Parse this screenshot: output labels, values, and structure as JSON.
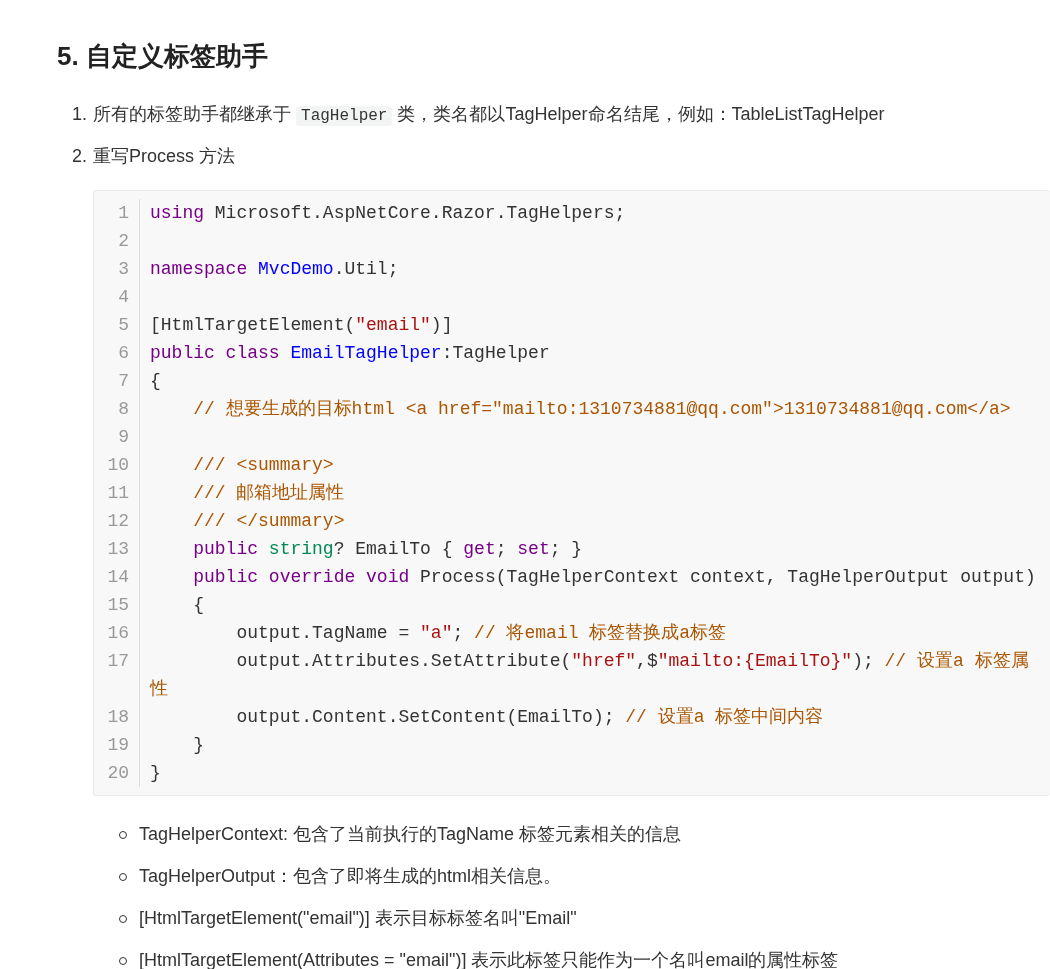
{
  "heading": "5. 自定义标签助手",
  "steps": [
    {
      "number": "1.",
      "parts": [
        {
          "kind": "text",
          "text": "所有的标签助手都继承于 "
        },
        {
          "kind": "code",
          "text": "TagHelper"
        },
        {
          "kind": "text",
          "text": " 类，类名都以TagHelper命名结尾，例如：TableListTagHelper"
        }
      ]
    },
    {
      "number": "2.",
      "parts": [
        {
          "kind": "text",
          "text": "重写Process 方法"
        }
      ]
    }
  ],
  "code_block": {
    "lines": [
      {
        "number": "1",
        "tokens": [
          {
            "kind": "keyword",
            "text": "using"
          },
          {
            "kind": "plain",
            "text": " Microsoft.AspNetCore.Razor.TagHelpers;"
          }
        ]
      },
      {
        "number": "2"
      },
      {
        "number": "3",
        "tokens": [
          {
            "kind": "keyword",
            "text": "namespace "
          },
          {
            "kind": "type",
            "text": "MvcDemo"
          },
          {
            "kind": "plain",
            "text": ".Util;"
          }
        ]
      },
      {
        "number": "4"
      },
      {
        "number": "5",
        "tokens": [
          {
            "kind": "plain",
            "text": "[HtmlTargetElement("
          },
          {
            "kind": "string",
            "text": "\"email\""
          },
          {
            "kind": "plain",
            "text": ")]"
          }
        ]
      },
      {
        "number": "6",
        "tokens": [
          {
            "kind": "keyword",
            "text": "public class "
          },
          {
            "kind": "type",
            "text": "EmailTagHelper"
          },
          {
            "kind": "plain",
            "text": ":TagHelper"
          }
        ]
      },
      {
        "number": "7",
        "tokens": [
          {
            "kind": "plain",
            "text": "{"
          }
        ]
      },
      {
        "number": "8",
        "tokens": [
          {
            "kind": "comment",
            "text": "    // 想要生成的目标html <a href=\"mailto:1310734881@qq.com\">1310734881@qq.com</a>"
          }
        ]
      },
      {
        "number": "9"
      },
      {
        "number": "10",
        "tokens": [
          {
            "kind": "comment",
            "text": "    /// <summary>"
          }
        ]
      },
      {
        "number": "11",
        "tokens": [
          {
            "kind": "comment",
            "text": "    /// 邮箱地址属性"
          }
        ]
      },
      {
        "number": "12",
        "tokens": [
          {
            "kind": "comment",
            "text": "    /// </summary>"
          }
        ]
      },
      {
        "number": "13",
        "tokens": [
          {
            "kind": "keyword",
            "text": "    public "
          },
          {
            "kind": "builtin",
            "text": "string"
          },
          {
            "kind": "plain",
            "text": "? EmailTo { "
          },
          {
            "kind": "keyword",
            "text": "get"
          },
          {
            "kind": "plain",
            "text": "; "
          },
          {
            "kind": "keyword",
            "text": "set"
          },
          {
            "kind": "plain",
            "text": "; }"
          }
        ]
      },
      {
        "number": "14",
        "tokens": [
          {
            "kind": "keyword",
            "text": "    public override void"
          },
          {
            "kind": "plain",
            "text": " Process(TagHelperContext context, TagHelperOutput output)"
          }
        ]
      },
      {
        "number": "15",
        "tokens": [
          {
            "kind": "plain",
            "text": "    {"
          }
        ]
      },
      {
        "number": "16",
        "tokens": [
          {
            "kind": "plain",
            "text": "        output.TagName = "
          },
          {
            "kind": "string",
            "text": "\"a\""
          },
          {
            "kind": "plain",
            "text": "; "
          },
          {
            "kind": "comment",
            "text": "// 将email 标签替换成a标签"
          }
        ]
      },
      {
        "number": "17",
        "tokens": [
          {
            "kind": "plain",
            "text": "        output.Attributes.SetAttribute("
          },
          {
            "kind": "string",
            "text": "\"href\""
          },
          {
            "kind": "plain",
            "text": ",$"
          },
          {
            "kind": "string",
            "text": "\"mailto:{EmailTo}\""
          },
          {
            "kind": "plain",
            "text": "); "
          },
          {
            "kind": "comment",
            "text": "// 设置a 标签属性"
          }
        ]
      },
      {
        "number": "18",
        "tokens": [
          {
            "kind": "plain",
            "text": "        output.Content.SetContent(EmailTo); "
          },
          {
            "kind": "comment",
            "text": "// 设置a 标签中间内容"
          }
        ]
      },
      {
        "number": "19",
        "tokens": [
          {
            "kind": "plain",
            "text": "    }"
          }
        ]
      },
      {
        "number": "20",
        "tokens": [
          {
            "kind": "plain",
            "text": "}"
          }
        ]
      }
    ]
  },
  "notes": [
    "TagHelperContext: 包含了当前执行的TagName 标签元素相关的信息",
    "TagHelperOutput：包含了即将生成的html相关信息。",
    "[HtmlTargetElement(\"email\")] 表示目标标签名叫\"Email\"",
    "[HtmlTargetElement(Attributes = \"email\")] 表示此标签只能作为一个名叫email的属性标签"
  ]
}
